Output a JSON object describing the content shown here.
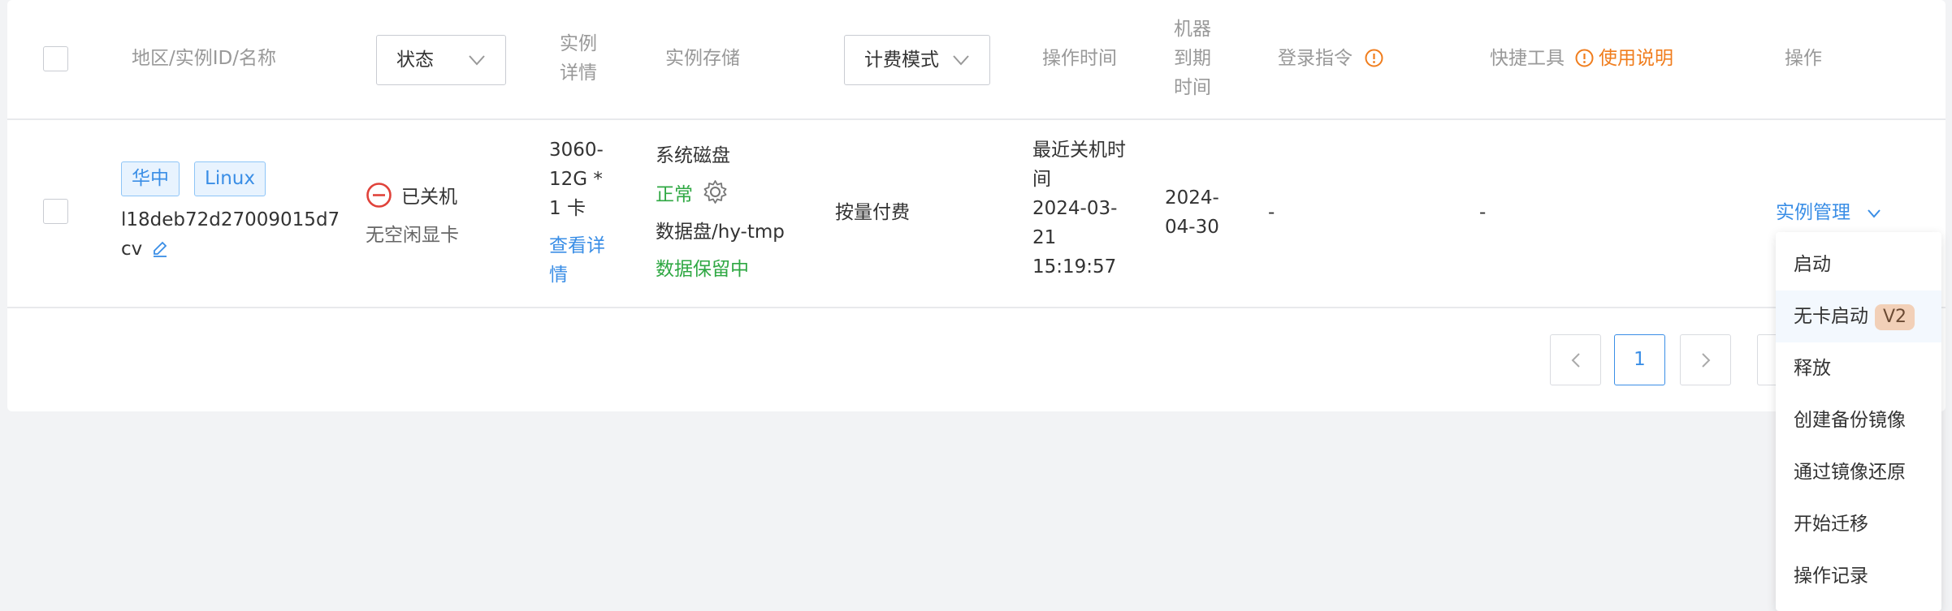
{
  "header": {
    "region_id_name": "地区/实例ID/名称",
    "status_select": "状态",
    "instance_detail_1": "实例",
    "instance_detail_2": "详情",
    "instance_storage": "实例存储",
    "billing_select": "计费模式",
    "op_time": "操作时间",
    "expire_1": "机器",
    "expire_2": "到期",
    "expire_3": "时间",
    "login_cmd": "登录指令",
    "quick_tools": "快捷工具",
    "usage_guide": "使用说明",
    "actions": "操作"
  },
  "row": {
    "region_tag": "华中",
    "os_tag": "Linux",
    "instance_id_1": "l18deb72d27009015d7",
    "instance_id_2": "cv",
    "status": "已关机",
    "status_sub": "无空闲显卡",
    "gpu_1": "3060-",
    "gpu_2": "12G *",
    "gpu_3": "1 卡",
    "view_detail_1": "查看详",
    "view_detail_2": "情",
    "sys_disk": "系统磁盘",
    "sys_disk_status": "正常",
    "data_disk": "数据盘/hy-tmp",
    "data_disk_status": "数据保留中",
    "billing": "按量付费",
    "op_time_1": "最近关机时",
    "op_time_2": "间",
    "op_time_3": "2024-03-",
    "op_time_4": "21",
    "op_time_5": "15:19:57",
    "expire_1": "2024-",
    "expire_2": "04-30",
    "login_cmd": "-",
    "quick_tools": "-",
    "manage": "实例管理"
  },
  "pagination": {
    "current_page": "1"
  },
  "menu": {
    "items": [
      "启动",
      "无卡启动",
      "释放",
      "创建备份镜像",
      "通过镜像还原",
      "开始迁移",
      "操作记录"
    ],
    "badge": "V2"
  },
  "colors": {
    "accent": "#3a8ee6",
    "success": "#2fa843",
    "warning": "#f07d1d",
    "danger": "#e0423a"
  }
}
